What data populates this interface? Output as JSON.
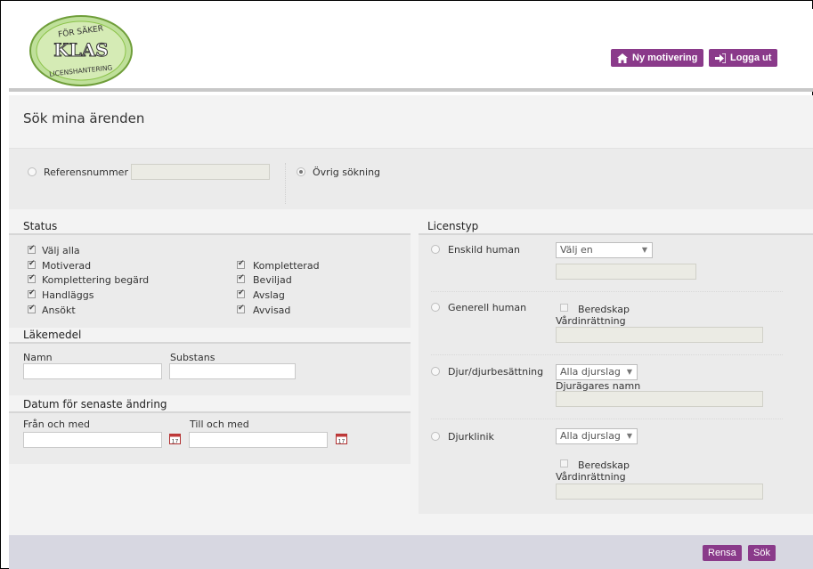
{
  "logo": {
    "line1": "FÖR SÄKER",
    "line2": "KLAS",
    "line3": "LICENSHANTERING"
  },
  "header": {
    "new_motivation": "Ny motivering",
    "logout": "Logga ut"
  },
  "page_title": "Sök mina ärenden",
  "search": {
    "reference_label": "Referensnummer",
    "reference_value": "",
    "other_search_label": "Övrig sökning",
    "selected": "other"
  },
  "status": {
    "heading": "Status",
    "select_all": "Välj alla",
    "left": [
      "Motiverad",
      "Komplettering begärd",
      "Handläggs",
      "Ansökt"
    ],
    "right": [
      "Kompletterad",
      "Beviljad",
      "Avslag",
      "Avvisad"
    ]
  },
  "lakemedel": {
    "heading": "Läkemedel",
    "name_label": "Namn",
    "substance_label": "Substans"
  },
  "datum": {
    "heading": "Datum för senaste ändring",
    "from_label": "Från och med",
    "to_label": "Till och med",
    "cal_day": "17"
  },
  "licenstyp": {
    "heading": "Licenstyp",
    "enskild": {
      "label": "Enskild human",
      "select": "Välj en"
    },
    "generell": {
      "label": "Generell human",
      "beredskap": "Beredskap",
      "vardinrattning": "Vårdinrättning"
    },
    "djur": {
      "label": "Djur/djurbesättning",
      "select": "Alla djurslag",
      "owner": "Djurägares namn"
    },
    "djurklinik": {
      "label": "Djurklinik",
      "select": "Alla djurslag",
      "beredskap": "Beredskap",
      "vardinrattning": "Vårdinrättning"
    }
  },
  "footer": {
    "clear": "Rensa",
    "search": "Sök"
  },
  "colors": {
    "brand": "#8a3a8a",
    "logo_green": "#8cc34a",
    "footer": "#d7d7e1"
  }
}
